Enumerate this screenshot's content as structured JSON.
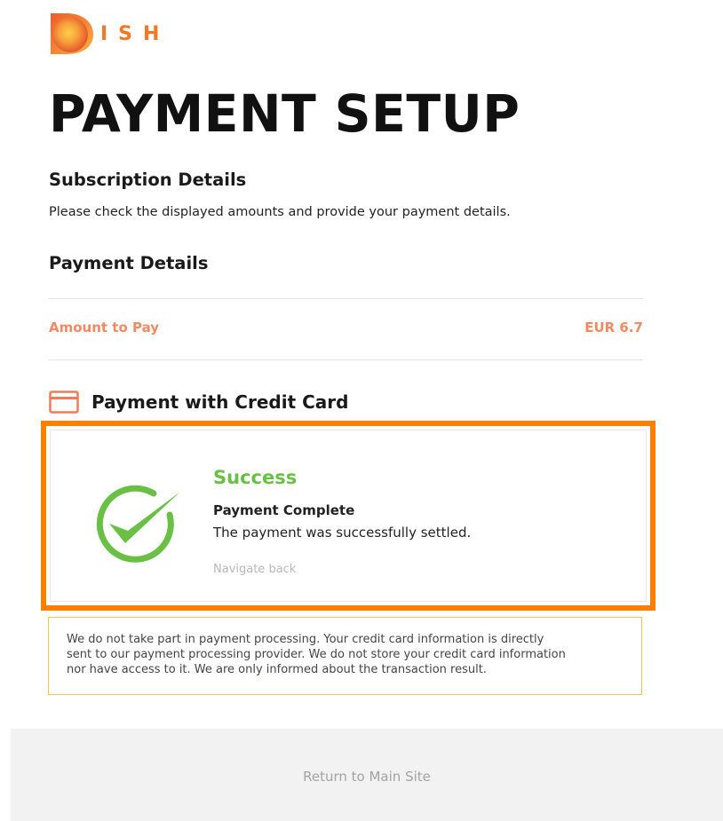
{
  "brand": {
    "logo_text": "ISH",
    "accent_color": "#f07a2a"
  },
  "page": {
    "title": "PAYMENT SETUP"
  },
  "subscription": {
    "heading": "Subscription Details",
    "instruction": "Please check the displayed amounts and provide your payment details."
  },
  "payment_details": {
    "heading": "Payment Details",
    "amount_label": "Amount to Pay",
    "amount_value": "EUR 6.7",
    "amount_color": "#f08a62"
  },
  "credit_card": {
    "heading": "Payment with Credit Card",
    "icon": "credit-card-icon"
  },
  "result": {
    "status": "Success",
    "status_color": "#6abf45",
    "title": "Payment Complete",
    "message": "The payment was successfully settled.",
    "navigate_back_label": "Navigate back",
    "icon": "check-circle-icon",
    "highlight_color": "#ff8000"
  },
  "notice": {
    "line1": "We do not take part in payment processing. Your credit card information is directly",
    "line2": "sent to our payment processing provider. We do not store your credit card information",
    "line3": "nor have access to it. We are only informed about the transaction result.",
    "border_color": "#f5c451"
  },
  "footer": {
    "return_label": "Return to Main Site"
  }
}
